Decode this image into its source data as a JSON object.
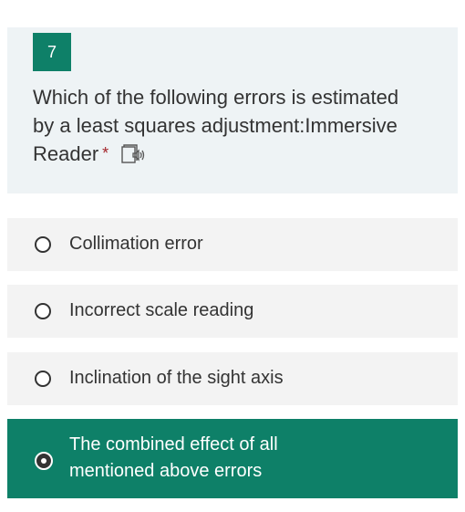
{
  "question": {
    "number": "7",
    "text": "Which of the following errors is estimated by a least squares adjustment:Immersive Reader",
    "required_mark": "*",
    "reader_icon": "immersive-reader-icon"
  },
  "options": [
    {
      "label": "Collimation error",
      "selected": false
    },
    {
      "label": "Incorrect scale reading",
      "selected": false
    },
    {
      "label": "Inclination of the sight axis",
      "selected": false
    },
    {
      "label": "The combined effect of all mentioned above errors",
      "selected": true
    }
  ],
  "colors": {
    "accent": "#0e8068",
    "question_bg": "#eef3f5",
    "option_bg": "#f3f3f3",
    "required": "#a4262c"
  }
}
